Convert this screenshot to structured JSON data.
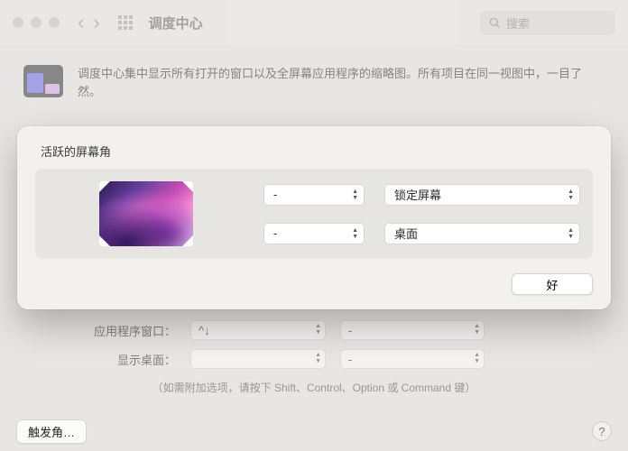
{
  "toolbar": {
    "title": "调度中心",
    "search_placeholder": "搜索"
  },
  "description": "调度中心集中显示所有打开的窗口以及全屏幕应用程序的缩略图。所有项目在同一视图中，一目了然。",
  "sheet": {
    "title": "活跃的屏幕角",
    "corners": {
      "top_left": "-",
      "top_right": "锁定屏幕",
      "bottom_left": "-",
      "bottom_right": "桌面"
    },
    "ok_label": "好"
  },
  "background": {
    "app_windows_label": "应用程序窗口：",
    "app_windows_shortcut": "^↓",
    "app_windows_mouse": "-",
    "show_desktop_label": "显示桌面：",
    "show_desktop_shortcut": "",
    "show_desktop_mouse": "-",
    "hint": "（如需附加选项，请按下 Shift、Control、Option 或 Command 键）",
    "hot_corners_button": "触发角…"
  }
}
